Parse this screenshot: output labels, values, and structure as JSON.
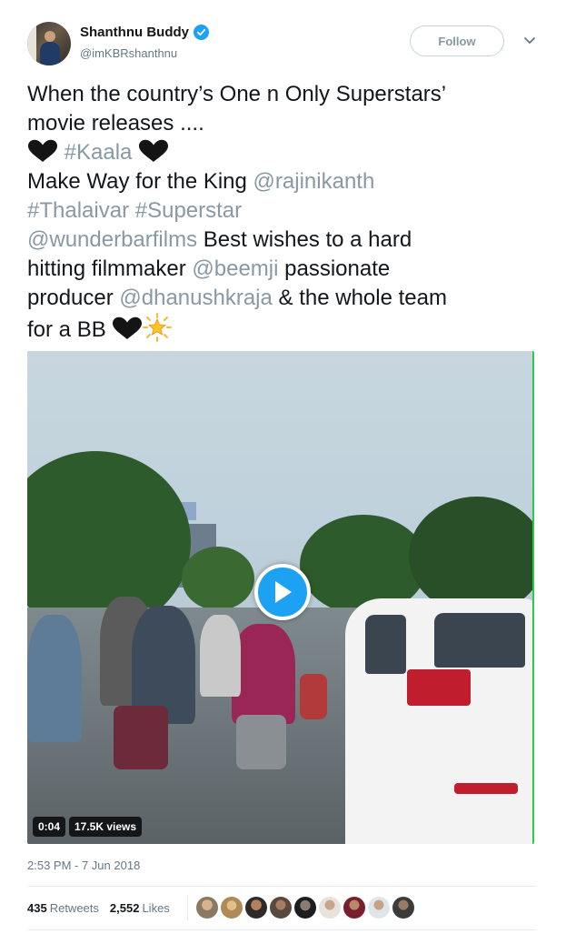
{
  "user": {
    "display_name": "Shanthnu Buddy",
    "handle": "@imKBRshanthnu",
    "verified_icon": "verified-badge-icon"
  },
  "actions": {
    "follow_label": "Follow",
    "more_icon": "chevron-down-icon"
  },
  "tweet": {
    "line1": "When the country’s One n Only Superstars’",
    "line2": "movie releases ....",
    "hashtag_kaala": "#Kaala",
    "line4_text": "Make Way for the King ",
    "mention_rajini": "@rajinikanth",
    "hashtag_thalaivar": "#Thalaivar",
    "hashtag_superstar": "#Superstar",
    "mention_wunderbar": "@wunderbarfilms",
    "line6_text": " Best wishes to a hard",
    "line7_text": "hitting filmmaker ",
    "mention_beemji": "@beemji",
    "line7_end": " passionate",
    "line8_text": "producer ",
    "mention_dhanush": "@dhanushkraja",
    "line8_end": " & the whole team",
    "line9_text": "for a BB "
  },
  "video": {
    "duration": "0:04",
    "views": "17.5K views",
    "play_icon": "play-icon"
  },
  "meta": {
    "timestamp": "2:53 PM - 7 Jun 2018"
  },
  "stats": {
    "retweets_count": "435",
    "retweets_label": "Retweets",
    "likes_count": "2,552",
    "likes_label": "Likes"
  },
  "colors": {
    "accent": "#1da1f2",
    "hashtag_gray": "#8899a6",
    "text": "#14171a",
    "muted": "#657786"
  }
}
